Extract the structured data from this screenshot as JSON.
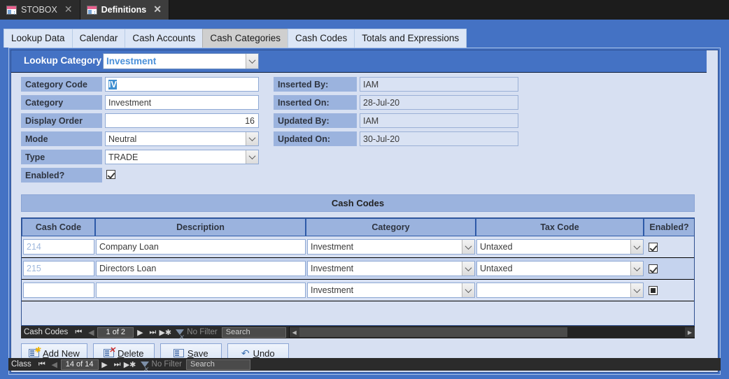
{
  "window": {
    "document_tabs": [
      {
        "title": "STOBOX",
        "icon": "form-icon",
        "close": "✕",
        "active": false
      },
      {
        "title": "Definitions",
        "icon": "form-icon",
        "close": "✕",
        "active": true
      }
    ]
  },
  "nav_tabs": [
    {
      "label": "Lookup Data",
      "selected": false
    },
    {
      "label": "Calendar",
      "selected": false
    },
    {
      "label": "Cash Accounts",
      "selected": false
    },
    {
      "label": "Cash Categories",
      "selected": true
    },
    {
      "label": "Cash Codes",
      "selected": false
    },
    {
      "label": "Totals and Expressions",
      "selected": false
    }
  ],
  "header": {
    "lookup_category_label": "Lookup Category",
    "lookup_category_value": "Investment"
  },
  "detail": {
    "left": [
      {
        "label": "Category Code",
        "value": "IV",
        "kind": "text",
        "selected": true
      },
      {
        "label": "Category",
        "value": "Investment",
        "kind": "text"
      },
      {
        "label": "Display Order",
        "value": "16",
        "kind": "number"
      },
      {
        "label": "Mode",
        "value": "Neutral",
        "kind": "combo"
      },
      {
        "label": "Type",
        "value": "TRADE",
        "kind": "combo"
      },
      {
        "label": "Enabled?",
        "value": "",
        "kind": "checkbox",
        "checked": true
      }
    ],
    "right": [
      {
        "label": "Inserted By:",
        "value": "IAM"
      },
      {
        "label": "Inserted On:",
        "value": "28-Jul-20"
      },
      {
        "label": "Updated By:",
        "value": "IAM"
      },
      {
        "label": "Updated On:",
        "value": "30-Jul-20"
      }
    ]
  },
  "subform": {
    "title": "Cash Codes",
    "columns": [
      "Cash Code",
      "Description",
      "Category",
      "Tax Code",
      "Enabled?"
    ],
    "rows": [
      {
        "cash_code": "214",
        "description": "Company Loan",
        "category": "Investment",
        "tax_code": "Untaxed",
        "enabled": "checked",
        "alt": false
      },
      {
        "cash_code": "215",
        "description": "Directors Loan",
        "category": "Investment",
        "tax_code": "Untaxed",
        "enabled": "checked",
        "alt": true
      },
      {
        "cash_code": "",
        "description": "",
        "category": "Investment",
        "tax_code": "",
        "enabled": "filled",
        "alt": false
      }
    ],
    "nav": {
      "label": "Cash Codes",
      "first": "⏮",
      "prev": "◀",
      "position": "1 of 2",
      "next": "▶",
      "last": "⏭",
      "new": "▶✱",
      "filter": "No Filter",
      "search_placeholder": "Search"
    }
  },
  "commands": [
    {
      "label_pre": "",
      "accel": "A",
      "label_post": "dd New",
      "icon": "add-new-icon",
      "badge": "✱"
    },
    {
      "label_pre": "",
      "accel": "D",
      "label_post": "elete",
      "icon": "delete-icon",
      "badge": "✕"
    },
    {
      "label_pre": "",
      "accel": "S",
      "label_post": "ave",
      "icon": "save-icon",
      "badge": ""
    },
    {
      "label_pre": "",
      "accel": "U",
      "label_post": "ndo",
      "icon": "undo-icon",
      "badge": "↶"
    }
  ],
  "record_nav": {
    "label": "Class",
    "first": "⏮",
    "prev": "◀",
    "position": "14 of 14",
    "next": "▶",
    "last": "⏭",
    "new": "▶✱",
    "filter": "No Filter",
    "search_placeholder": "Search"
  },
  "colors": {
    "accent": "#4472c4",
    "form_bg": "#d7e0f2",
    "label_bg": "#9bb3de",
    "header_band": "#4472c4",
    "readonly_bg": "#d9e2f3",
    "alt_row": "#c5d3ee",
    "selection": "#3f8fd0",
    "navbar_bg": "#2b2b2b"
  }
}
